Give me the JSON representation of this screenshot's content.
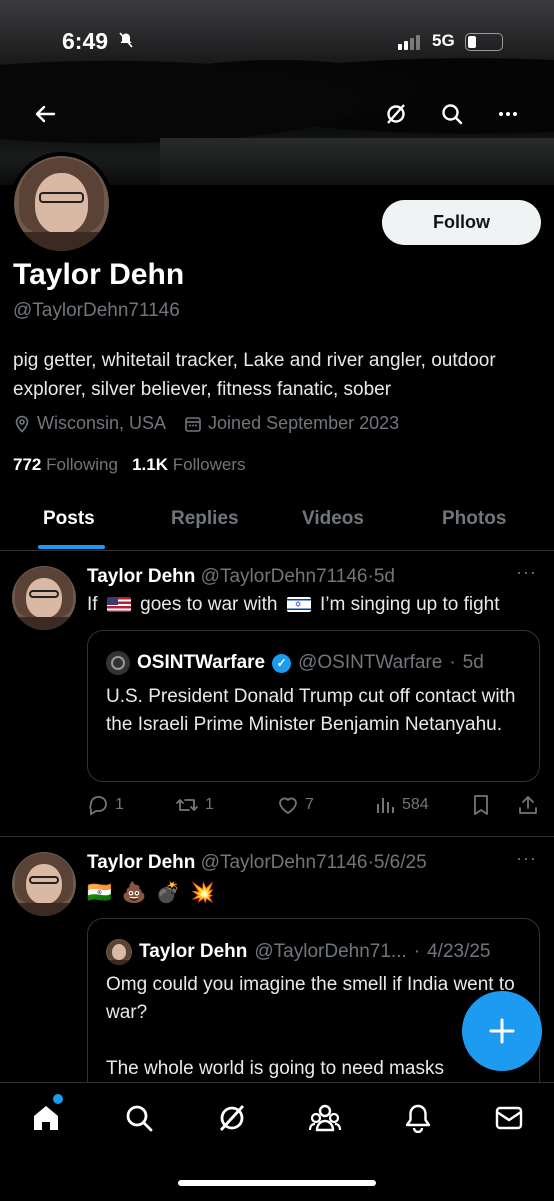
{
  "status_bar": {
    "time": "6:49",
    "network": "5G"
  },
  "profile": {
    "name": "Taylor Dehn",
    "handle": "@TaylorDehn71146",
    "follow_label": "Follow",
    "bio": "pig getter, whitetail tracker, Lake and river angler, outdoor explorer, silver believer, fitness fanatic, sober",
    "location": "Wisconsin, USA",
    "joined": "Joined September 2023",
    "following_count": "772",
    "following_label": "Following",
    "followers_count": "1.1K",
    "followers_label": "Followers"
  },
  "tabs": [
    "Posts",
    "Replies",
    "Videos",
    "Photos"
  ],
  "posts": [
    {
      "name": "Taylor Dehn",
      "handle": "@TaylorDehn71146",
      "time": "5d",
      "text_a": "If",
      "text_b": "goes to war with",
      "text_c": "I’m singing up to fight",
      "quote": {
        "name": "OSINTWarfare",
        "handle": "@OSINTWarfare",
        "time": "5d",
        "text": "U.S. President Donald Trump cut off contact with the Israeli Prime Minister Benjamin Netanyahu."
      },
      "replies": "1",
      "reposts": "1",
      "likes": "7",
      "views": "584"
    },
    {
      "name": "Taylor Dehn",
      "handle": "@TaylorDehn71146",
      "time": "5/6/25",
      "text": "🇮🇳 💩 💣 💥",
      "quote": {
        "name": "Taylor Dehn",
        "handle": "@TaylorDehn71...",
        "time": "4/23/25",
        "text": "Omg could you imagine the smell if India went to war?\n\nThe whole world is going to need masks"
      }
    }
  ],
  "colors": {
    "accent": "#1d9bf0",
    "muted": "#71767b",
    "background": "#000000"
  }
}
